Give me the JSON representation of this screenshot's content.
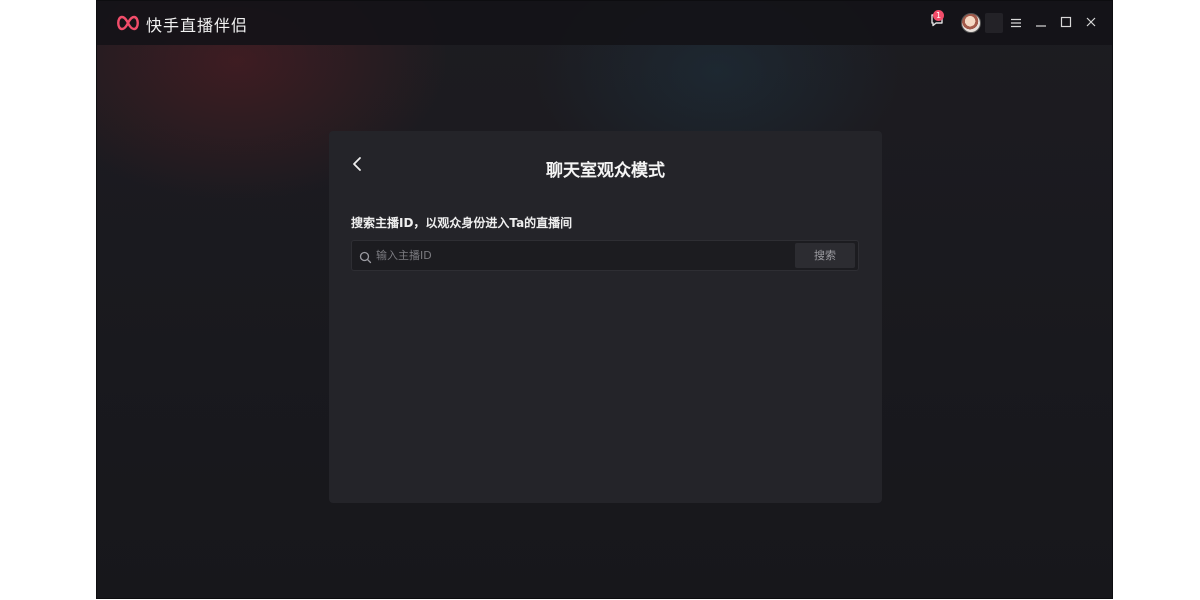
{
  "app": {
    "title": "快手直播伴侣",
    "notification_count": "1"
  },
  "panel": {
    "title": "聊天室观众模式",
    "search_label": "搜索主播ID，以观众身份进入Ta的直播间",
    "search_placeholder": "输入主播ID",
    "search_value": "",
    "search_button": "搜索"
  },
  "colors": {
    "brand": "#f24d6a",
    "panel_bg": "#242429",
    "window_bg": "#1b1b20"
  },
  "icons": {
    "logo": "kuaishou-logo-icon",
    "notify": "message-bell-icon",
    "menu": "hamburger-menu-icon",
    "minimize": "minimize-icon",
    "maximize": "maximize-icon",
    "close": "close-icon",
    "back": "chevron-left-icon",
    "search": "search-icon"
  }
}
